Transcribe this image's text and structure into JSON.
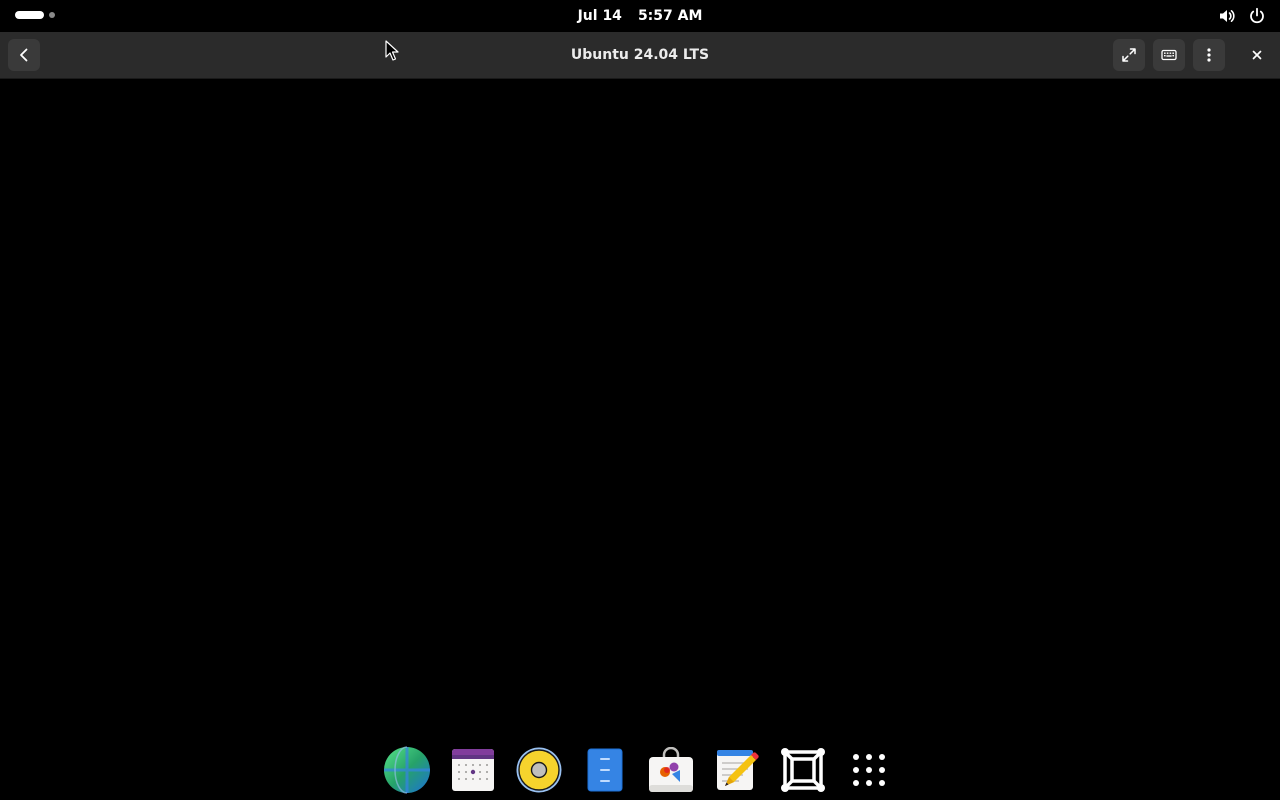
{
  "topbar": {
    "date": "Jul 14",
    "time": "5:57 AM",
    "tray_icons": [
      "volume-icon",
      "power-icon"
    ]
  },
  "headerbar": {
    "title": "Ubuntu 24.04 LTS",
    "buttons": [
      "back-icon",
      "fullscreen-icon",
      "keyboard-icon",
      "menu-icon",
      "close-icon"
    ]
  },
  "dock": {
    "apps": [
      "web-browser-icon",
      "calendar-icon",
      "music-player-icon",
      "file-manager-icon",
      "software-store-icon",
      "text-editor-icon",
      "boxes-icon",
      "app-grid-icon"
    ]
  },
  "colors": {
    "background": "#000000",
    "headerbar": "#2b2b2b",
    "button": "#3a3a3a"
  }
}
